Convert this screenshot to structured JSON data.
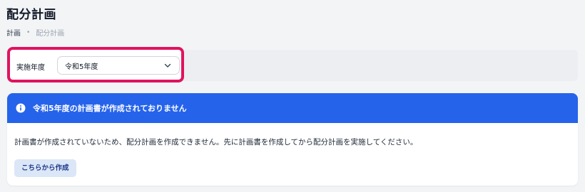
{
  "page": {
    "title": "配分計画"
  },
  "breadcrumb": {
    "items": [
      "計画",
      "配分計画"
    ],
    "separator": "•"
  },
  "filter": {
    "label": "実施年度",
    "selected": "令和5年度",
    "icon": "chevron-down-icon"
  },
  "alert": {
    "title": "令和5年度の計画書が作成されておりません",
    "message": "計画書が作成されていないため、配分計画を作成できません。先に計画書を作成してから配分計画を実施してください。",
    "button_label": "こちらから作成",
    "icon": "info-icon"
  },
  "colors": {
    "accent": "#2563eb",
    "highlight": "#e0135f",
    "button_bg": "#dbe6f7",
    "button_text": "#1e3a8a"
  }
}
